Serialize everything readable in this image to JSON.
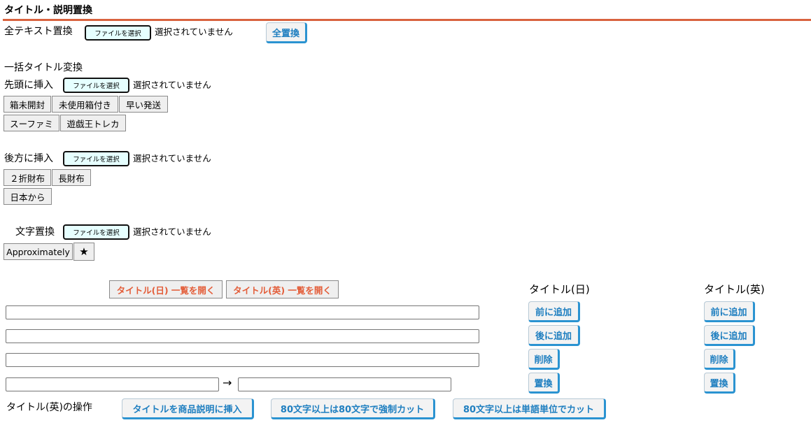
{
  "header": {
    "title": "タイトル・説明置換"
  },
  "colors": {
    "accent_line": "#d9633f",
    "blue_button_text": "#1f7fc0",
    "orange_button_text": "#e35d39",
    "file_button_bg": "#e6ffff"
  },
  "full_replace": {
    "label": "全テキスト置換",
    "file_button": "ファイルを選択",
    "file_status": "選択されていません",
    "replace_all": "全置換"
  },
  "bulk": {
    "title": "一括タイトル変換"
  },
  "prefix": {
    "label": "先頭に挿入",
    "file_button": "ファイルを選択",
    "file_status": "選択されていません",
    "tags": [
      "箱未開封",
      "未使用箱付き",
      "早い発送",
      "スーファミ",
      "遊戯王トレカ"
    ]
  },
  "suffix": {
    "label": "後方に挿入",
    "file_button": "ファイルを選択",
    "file_status": "選択されていません",
    "tags": [
      "２折財布",
      "長財布",
      "日本から"
    ]
  },
  "charrep": {
    "label": "文字置換",
    "file_button": "ファイルを選択",
    "file_status": "選択されていません",
    "tags": [
      "Approximately",
      "★"
    ]
  },
  "lists": {
    "open_jp": "タイトル(日) 一覧を開く",
    "open_en": "タイトル(英) 一覧を開く"
  },
  "columns": {
    "jp": {
      "heading": "タイトル(日)",
      "add_front": "前に追加",
      "add_back": "後に追加",
      "delete": "削除",
      "replace": "置換"
    },
    "en": {
      "heading": "タイトル(英)",
      "add_front": "前に追加",
      "add_back": "後に追加",
      "delete": "削除",
      "replace": "置換"
    }
  },
  "inputs": {
    "prepend_value": "",
    "append_value": "",
    "delete_value": "",
    "replace_from": "",
    "replace_to": "",
    "arrow": "→"
  },
  "en_ops": {
    "label": "タイトル(英)の操作",
    "insert_desc": "タイトルを商品説明に挿入",
    "force_cut": "80文字以上は80文字で強制カット",
    "word_cut": "80文字以上は単語単位でカット"
  }
}
